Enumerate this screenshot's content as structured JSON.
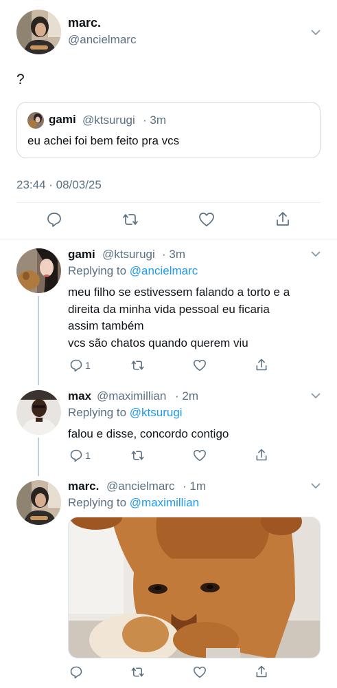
{
  "main_tweet": {
    "author_name": "marc.",
    "author_handle": "@ancielmarc",
    "text": "?",
    "quoted": {
      "author_name": "gami",
      "author_handle": "@ktsurugi",
      "time": "· 3m",
      "text": "eu achei foi bem feito pra vcs"
    },
    "timestamp": "23:44 · 08/03/25"
  },
  "replies": [
    {
      "author_name": "gami",
      "author_handle": "@ktsurugi",
      "time": "· 3m",
      "replying_prefix": "Replying to",
      "replying_to": "@ancielmarc",
      "text_lines": [
        "meu filho se estivessem falando a torto e a",
        "direita da minha vida pessoal eu ficaria",
        "assim também",
        "vcs são chatos quando querem viu"
      ],
      "reply_count": "1"
    },
    {
      "author_name": "max",
      "author_handle": "@maximillian",
      "time": "· 2m",
      "replying_prefix": "Replying to",
      "replying_to": "@ktsurugi",
      "text_lines": [
        "falou e disse, concordo contigo"
      ],
      "reply_count": "1"
    },
    {
      "author_name": "marc.",
      "author_handle": "@ancielmarc",
      "time": "· 1m",
      "replying_prefix": "Replying to",
      "replying_to": "@maximillian",
      "text_lines": [],
      "reply_count": ""
    }
  ],
  "icons": {
    "reply": "reply-icon",
    "retweet": "retweet-icon",
    "like": "heart-icon",
    "share": "share-icon",
    "more": "chevron-down-icon"
  },
  "colors": {
    "link": "#1d9bf0",
    "muted": "#5b7083",
    "border": "#e6ecf0"
  }
}
